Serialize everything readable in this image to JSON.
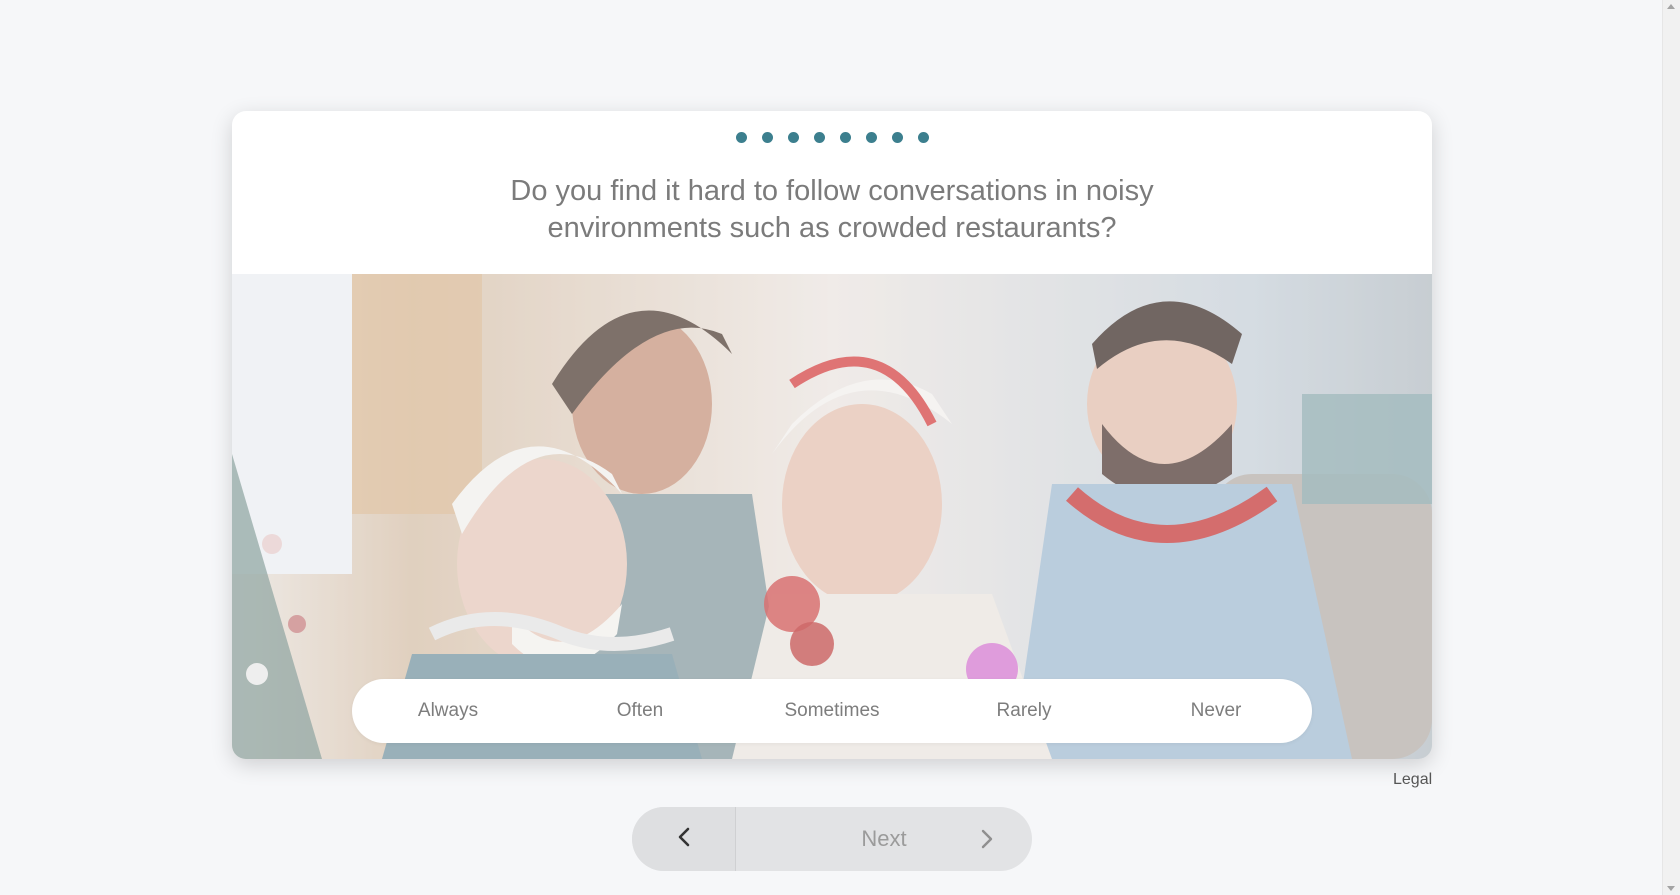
{
  "survey": {
    "question": "Do you find it hard to follow conversations in noisy environments such as crowded restaurants?",
    "progress_step_count": 8,
    "answers": [
      "Always",
      "Often",
      "Sometimes",
      "Rarely",
      "Never"
    ],
    "accent_color": "#3c7f8e"
  },
  "footer": {
    "legal_label": "Legal"
  },
  "navigation": {
    "back_icon": "chevron-left-icon",
    "next_label": "Next",
    "next_icon": "chevron-right-icon"
  }
}
